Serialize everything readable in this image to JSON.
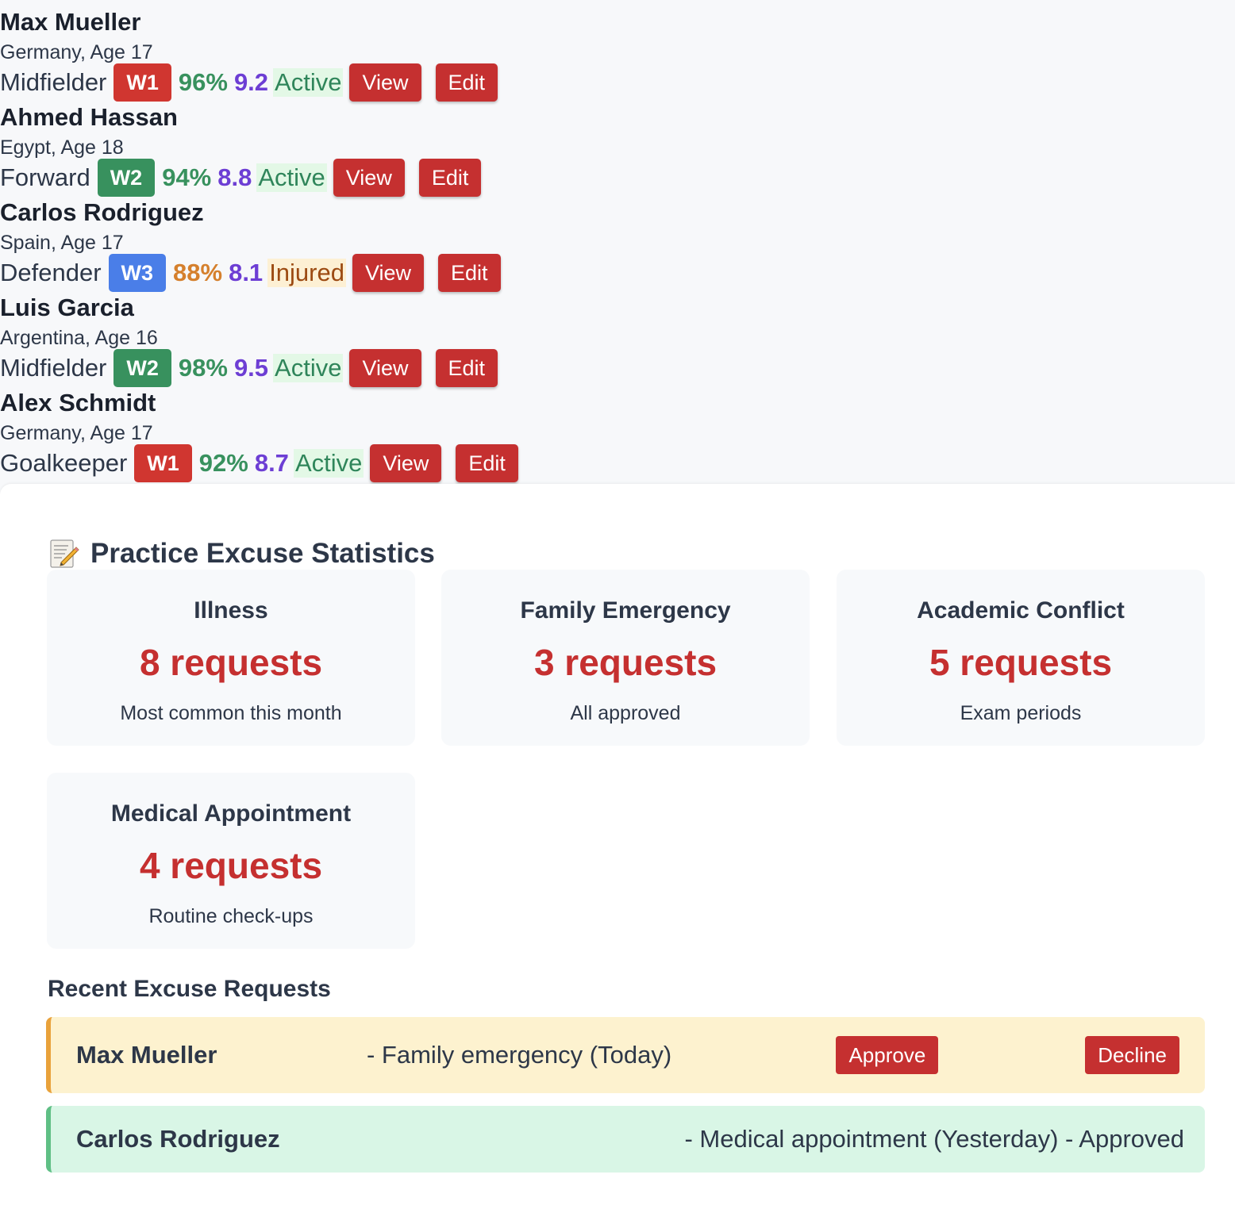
{
  "players": [
    {
      "name": "Max Mueller",
      "meta": "Germany, Age 17",
      "position": "Midfielder",
      "wave": "W1",
      "attendance": "96%",
      "rating": "9.2",
      "status": "Active",
      "view_label": "View",
      "edit_label": "Edit"
    },
    {
      "name": "Ahmed Hassan",
      "meta": "Egypt, Age 18",
      "position": "Forward",
      "wave": "W2",
      "attendance": "94%",
      "rating": "8.8",
      "status": "Active",
      "view_label": "View",
      "edit_label": "Edit"
    },
    {
      "name": "Carlos Rodriguez",
      "meta": "Spain, Age 17",
      "position": "Defender",
      "wave": "W3",
      "attendance": "88%",
      "rating": "8.1",
      "status": "Injured",
      "view_label": "View",
      "edit_label": "Edit"
    },
    {
      "name": "Luis Garcia",
      "meta": "Argentina, Age 16",
      "position": "Midfielder",
      "wave": "W2",
      "attendance": "98%",
      "rating": "9.5",
      "status": "Active",
      "view_label": "View",
      "edit_label": "Edit"
    },
    {
      "name": "Alex Schmidt",
      "meta": "Germany, Age 17",
      "position": "Goalkeeper",
      "wave": "W1",
      "attendance": "92%",
      "rating": "8.7",
      "status": "Active",
      "view_label": "View",
      "edit_label": "Edit"
    }
  ],
  "colors": {
    "wave_W1": "#d03630",
    "wave_W2": "#38915e",
    "wave_W3": "#4a7ee8",
    "attendance_high": "#38915e",
    "attendance_mid": "#d5802d",
    "rating": "#6d3ed4",
    "button": "#c53030"
  },
  "excuse_stats": {
    "title": "Practice Excuse Statistics",
    "icon": "memo-icon",
    "cards": [
      {
        "label": "Illness",
        "value": "8 requests",
        "desc": "Most common this month"
      },
      {
        "label": "Family Emergency",
        "value": "3 requests",
        "desc": "All approved"
      },
      {
        "label": "Academic Conflict",
        "value": "5 requests",
        "desc": "Exam periods"
      },
      {
        "label": "Medical Appointment",
        "value": "4 requests",
        "desc": "Routine check-ups"
      }
    ]
  },
  "recent_requests": {
    "title": "Recent Excuse Requests",
    "items": [
      {
        "name": "Max Mueller",
        "text": "- Family emergency (Today)",
        "approve_label": "Approve",
        "decline_label": "Decline"
      },
      {
        "name": "Carlos Rodriguez",
        "text": "- Medical appointment (Yesterday) - Approved"
      }
    ]
  }
}
